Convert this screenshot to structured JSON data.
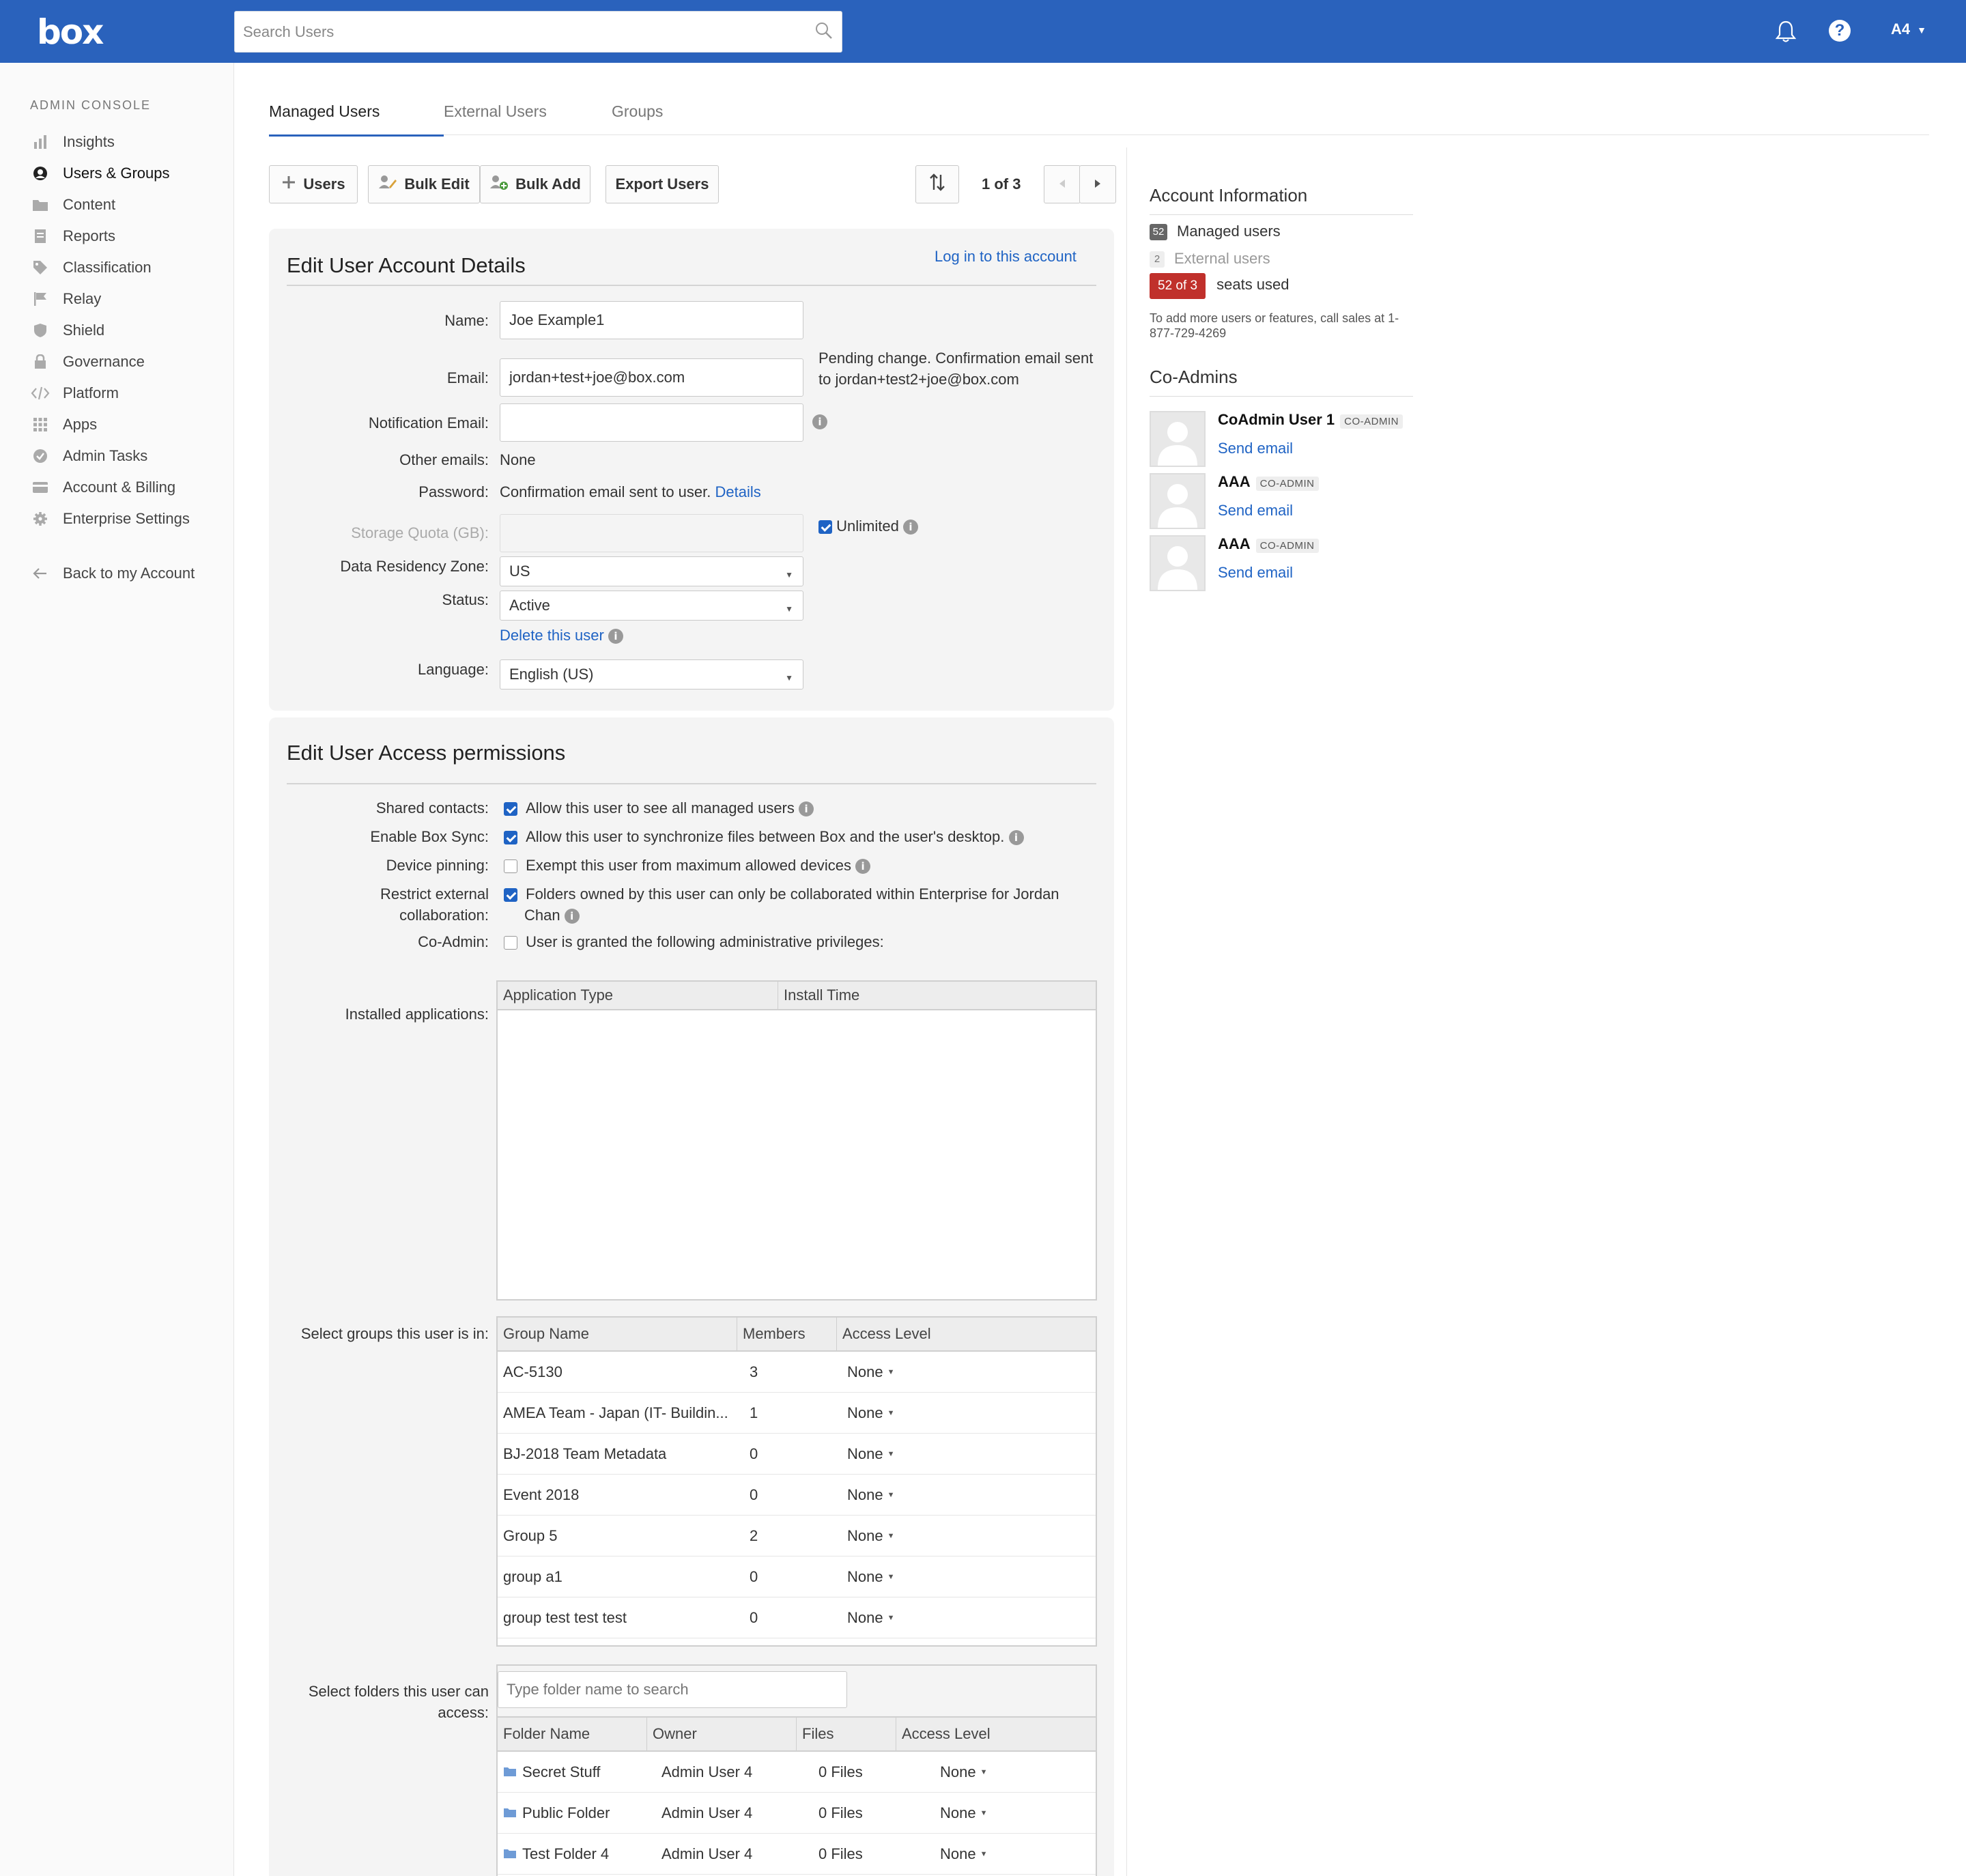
{
  "header": {
    "logo": "box",
    "search_placeholder": "Search Users",
    "user_initials": "A4",
    "help_glyph": "?"
  },
  "sidebar": {
    "console_label": "ADMIN CONSOLE",
    "items": [
      {
        "label": "Insights",
        "icon": "bar-chart-icon"
      },
      {
        "label": "Users & Groups",
        "icon": "user-circle-icon"
      },
      {
        "label": "Content",
        "icon": "folder-icon"
      },
      {
        "label": "Reports",
        "icon": "document-icon"
      },
      {
        "label": "Classification",
        "icon": "tag-icon"
      },
      {
        "label": "Relay",
        "icon": "flag-icon"
      },
      {
        "label": "Shield",
        "icon": "shield-icon"
      },
      {
        "label": "Governance",
        "icon": "lock-icon"
      },
      {
        "label": "Platform",
        "icon": "code-icon"
      },
      {
        "label": "Apps",
        "icon": "grid-icon"
      },
      {
        "label": "Admin Tasks",
        "icon": "check-circle-icon"
      },
      {
        "label": "Account & Billing",
        "icon": "card-icon"
      },
      {
        "label": "Enterprise Settings",
        "icon": "gear-icon"
      }
    ],
    "back_label": "Back to my Account"
  },
  "tabs": [
    "Managed Users",
    "External Users",
    "Groups"
  ],
  "toolbar": {
    "users_label": "Users",
    "bulk_edit_label": "Bulk Edit",
    "bulk_add_label": "Bulk Add",
    "export_label": "Export Users",
    "pager_text": "1 of 3"
  },
  "account_details": {
    "title": "Edit User Account Details",
    "login_link": "Log in to this account",
    "name_label": "Name:",
    "name_value": "Joe Example1",
    "email_label": "Email:",
    "email_value": "jordan+test+joe@box.com",
    "pending_note_line1": "Pending change. Confirmation email sent",
    "pending_note_line2": "to jordan+test2+joe@box.com",
    "notification_label": "Notification Email:",
    "notification_value": "",
    "other_emails_label": "Other emails:",
    "other_emails_value": "None",
    "password_label": "Password:",
    "password_value": "Confirmation email sent to user.",
    "password_link": "Details",
    "quota_label": "Storage Quota (GB):",
    "unlimited_label": "Unlimited",
    "residency_label": "Data Residency Zone:",
    "residency_value": "US",
    "status_label": "Status:",
    "status_value": "Active",
    "delete_link": "Delete this user",
    "language_label": "Language:",
    "language_value": "English (US)"
  },
  "access_permissions": {
    "title": "Edit User Access permissions",
    "shared_contacts_label": "Shared contacts:",
    "shared_contacts_text": "Allow this user to see all managed users",
    "sync_label": "Enable Box Sync:",
    "sync_text": "Allow this user to synchronize files between Box and the user's desktop.",
    "pinning_label": "Device pinning:",
    "pinning_text": "Exempt this user from maximum allowed devices",
    "restrict_label_1": "Restrict external",
    "restrict_label_2": "collaboration:",
    "restrict_text_1": "Folders owned by this user can only be collaborated within Enterprise for Jordan",
    "restrict_text_2": "Chan",
    "coadmin_label": "Co-Admin:",
    "coadmin_text": "User is granted the following administrative privileges:",
    "installed_label": "Installed applications:",
    "apps_columns": [
      "Application Type",
      "Install Time"
    ],
    "groups_label": "Select groups this user is in:",
    "groups_columns": [
      "Group Name",
      "Members",
      "Access Level"
    ],
    "groups": [
      {
        "name": "AC-5130",
        "members": "3",
        "access": "None"
      },
      {
        "name": "AMEA Team - Japan (IT- Buildin...",
        "members": "1",
        "access": "None"
      },
      {
        "name": "BJ-2018 Team Metadata",
        "members": "0",
        "access": "None"
      },
      {
        "name": "Event 2018",
        "members": "0",
        "access": "None"
      },
      {
        "name": "Group 5",
        "members": "2",
        "access": "None"
      },
      {
        "name": "group a1",
        "members": "0",
        "access": "None"
      },
      {
        "name": "group test test test",
        "members": "0",
        "access": "None"
      }
    ],
    "folders_label_1": "Select folders this user can",
    "folders_label_2": "access:",
    "folder_search_placeholder": "Type folder name to search",
    "folders_columns": [
      "Folder Name",
      "Owner",
      "Files",
      "Access Level"
    ],
    "folders": [
      {
        "name": "Secret Stuff",
        "owner": "Admin User 4",
        "files": "0 Files",
        "access": "None"
      },
      {
        "name": "Public Folder",
        "owner": "Admin User 4",
        "files": "0 Files",
        "access": "None"
      },
      {
        "name": "Test Folder 4",
        "owner": "Admin User 4",
        "files": "0 Files",
        "access": "None"
      }
    ]
  },
  "account_info": {
    "title": "Account Information",
    "managed_count": "52",
    "managed_label": "Managed users",
    "external_count": "2",
    "external_label": "External users",
    "seats_badge": "52 of 3",
    "seats_label": "seats used",
    "note_line1": "To add more users or features, call sales at 1-",
    "note_line2": "877-729-4269",
    "seats_badge_color": "#c0302b"
  },
  "co_admins": {
    "title": "Co-Admins",
    "tag": "CO-ADMIN",
    "items": [
      {
        "name": "CoAdmin User 1",
        "link": "Send email"
      },
      {
        "name": "AAA",
        "link": "Send email"
      },
      {
        "name": "AAA",
        "link": "Send email"
      }
    ]
  },
  "colors": {
    "brand_blue": "#2a62bc",
    "link_blue": "#1f63c4"
  }
}
